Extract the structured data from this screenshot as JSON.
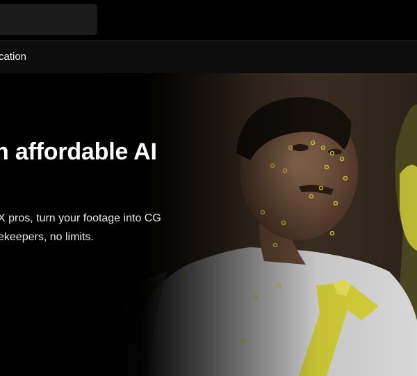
{
  "nav": {
    "item_label": "cation"
  },
  "hero": {
    "headline": "n affordable AI",
    "subtext_line1": "X pros, turn your footage into CG",
    "subtext_line2": "ekeepers, no limits."
  },
  "colors": {
    "accent": "#d8d23a",
    "background": "#000000"
  }
}
